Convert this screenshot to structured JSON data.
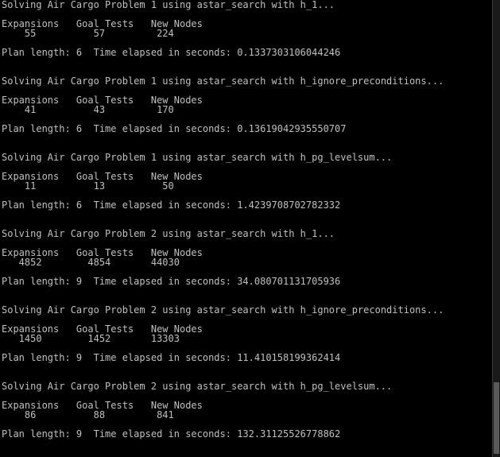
{
  "runs": [
    {
      "heading": "Solving Air Cargo Problem 1 using astar_search with h_1...",
      "header_row": "Expansions   Goal Tests   New Nodes",
      "values_row": "    55          57         224",
      "summary": "Plan length: 6  Time elapsed in seconds: 0.1337303106044246"
    },
    {
      "heading": "Solving Air Cargo Problem 1 using astar_search with h_ignore_preconditions...",
      "header_row": "Expansions   Goal Tests   New Nodes",
      "values_row": "    41          43         170",
      "summary": "Plan length: 6  Time elapsed in seconds: 0.13619042935550707"
    },
    {
      "heading": "Solving Air Cargo Problem 1 using astar_search with h_pg_levelsum...",
      "header_row": "Expansions   Goal Tests   New Nodes",
      "values_row": "    11          13          50",
      "summary": "Plan length: 6  Time elapsed in seconds: 1.4239708702782332"
    },
    {
      "heading": "Solving Air Cargo Problem 2 using astar_search with h_1...",
      "header_row": "Expansions   Goal Tests   New Nodes",
      "values_row": "   4852        4854       44030",
      "summary": "Plan length: 9  Time elapsed in seconds: 34.080701131705936"
    },
    {
      "heading": "Solving Air Cargo Problem 2 using astar_search with h_ignore_preconditions...",
      "header_row": "Expansions   Goal Tests   New Nodes",
      "values_row": "   1450        1452       13303",
      "summary": "Plan length: 9  Time elapsed in seconds: 11.410158199362414"
    },
    {
      "heading": "Solving Air Cargo Problem 2 using astar_search with h_pg_levelsum...",
      "header_row": "Expansions   Goal Tests   New Nodes",
      "values_row": "    86          88         841",
      "summary": "Plan length: 9  Time elapsed in seconds: 132.31125526778862"
    }
  ],
  "colors": {
    "background": "#000000",
    "text": "#c0c0c0"
  }
}
